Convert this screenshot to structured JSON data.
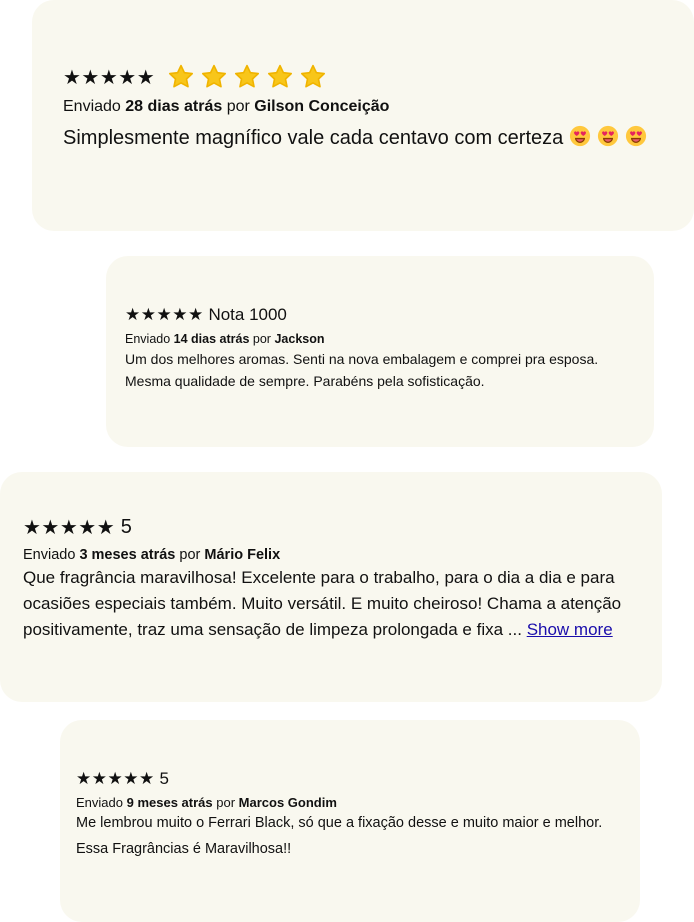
{
  "colors": {
    "card_background": "#f9f8ef",
    "star_yellow": "#f8c61a",
    "link_blue": "#1a0dab"
  },
  "reviews": [
    {
      "stars": "★★★★★",
      "star_icons": [
        "star-icon",
        "star-icon",
        "star-icon",
        "star-icon",
        "star-icon"
      ],
      "sent_prefix": "Enviado",
      "when": "28 dias atrás",
      "by": "por",
      "author": "Gilson Conceição",
      "text": "Simplesmente magnífico vale cada centavo com certeza",
      "emojis": [
        "heart-eyes-emoji",
        "heart-eyes-emoji",
        "heart-eyes-emoji"
      ]
    },
    {
      "stars": "★★★★★",
      "title": "Nota 1000",
      "sent_prefix": "Enviado",
      "when": "14 dias atrás",
      "by": "por",
      "author": "Jackson",
      "text": "Um dos melhores aromas. Senti na nova embalagem e comprei pra esposa. Mesma qualidade de sempre. Parabéns pela sofisticação."
    },
    {
      "stars": "★★★★★",
      "title": "5",
      "sent_prefix": "Enviado",
      "when": "3 meses atrás",
      "by": "por",
      "author": "Mário Felix",
      "text": "Que fragrância maravilhosa! Excelente para o trabalho, para o dia a dia e para ocasiões especiais também. Muito versátil. E muito cheiroso! Chama a atenção positivamente, traz uma sensação de limpeza prolongada e fixa ...",
      "show_more": "Show more"
    },
    {
      "stars": "★★★★★",
      "title": "5",
      "sent_prefix": "Enviado",
      "when": "9 meses atrás",
      "by": "por",
      "author": "Marcos Gondim",
      "text": "Me lembrou muito o Ferrari Black, só que a fixação desse e muito maior e melhor. Essa Fragrâncias é Maravilhosa!!"
    }
  ]
}
